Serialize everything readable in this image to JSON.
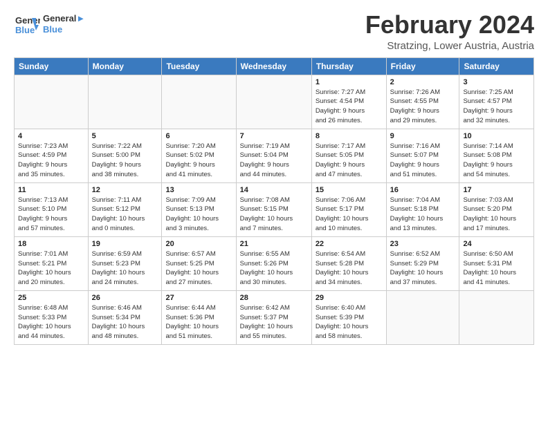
{
  "header": {
    "logo_general": "General",
    "logo_blue": "Blue",
    "month_year": "February 2024",
    "location": "Stratzing, Lower Austria, Austria"
  },
  "weekdays": [
    "Sunday",
    "Monday",
    "Tuesday",
    "Wednesday",
    "Thursday",
    "Friday",
    "Saturday"
  ],
  "weeks": [
    [
      {
        "day": "",
        "info": ""
      },
      {
        "day": "",
        "info": ""
      },
      {
        "day": "",
        "info": ""
      },
      {
        "day": "",
        "info": ""
      },
      {
        "day": "1",
        "info": "Sunrise: 7:27 AM\nSunset: 4:54 PM\nDaylight: 9 hours\nand 26 minutes."
      },
      {
        "day": "2",
        "info": "Sunrise: 7:26 AM\nSunset: 4:55 PM\nDaylight: 9 hours\nand 29 minutes."
      },
      {
        "day": "3",
        "info": "Sunrise: 7:25 AM\nSunset: 4:57 PM\nDaylight: 9 hours\nand 32 minutes."
      }
    ],
    [
      {
        "day": "4",
        "info": "Sunrise: 7:23 AM\nSunset: 4:59 PM\nDaylight: 9 hours\nand 35 minutes."
      },
      {
        "day": "5",
        "info": "Sunrise: 7:22 AM\nSunset: 5:00 PM\nDaylight: 9 hours\nand 38 minutes."
      },
      {
        "day": "6",
        "info": "Sunrise: 7:20 AM\nSunset: 5:02 PM\nDaylight: 9 hours\nand 41 minutes."
      },
      {
        "day": "7",
        "info": "Sunrise: 7:19 AM\nSunset: 5:04 PM\nDaylight: 9 hours\nand 44 minutes."
      },
      {
        "day": "8",
        "info": "Sunrise: 7:17 AM\nSunset: 5:05 PM\nDaylight: 9 hours\nand 47 minutes."
      },
      {
        "day": "9",
        "info": "Sunrise: 7:16 AM\nSunset: 5:07 PM\nDaylight: 9 hours\nand 51 minutes."
      },
      {
        "day": "10",
        "info": "Sunrise: 7:14 AM\nSunset: 5:08 PM\nDaylight: 9 hours\nand 54 minutes."
      }
    ],
    [
      {
        "day": "11",
        "info": "Sunrise: 7:13 AM\nSunset: 5:10 PM\nDaylight: 9 hours\nand 57 minutes."
      },
      {
        "day": "12",
        "info": "Sunrise: 7:11 AM\nSunset: 5:12 PM\nDaylight: 10 hours\nand 0 minutes."
      },
      {
        "day": "13",
        "info": "Sunrise: 7:09 AM\nSunset: 5:13 PM\nDaylight: 10 hours\nand 3 minutes."
      },
      {
        "day": "14",
        "info": "Sunrise: 7:08 AM\nSunset: 5:15 PM\nDaylight: 10 hours\nand 7 minutes."
      },
      {
        "day": "15",
        "info": "Sunrise: 7:06 AM\nSunset: 5:17 PM\nDaylight: 10 hours\nand 10 minutes."
      },
      {
        "day": "16",
        "info": "Sunrise: 7:04 AM\nSunset: 5:18 PM\nDaylight: 10 hours\nand 13 minutes."
      },
      {
        "day": "17",
        "info": "Sunrise: 7:03 AM\nSunset: 5:20 PM\nDaylight: 10 hours\nand 17 minutes."
      }
    ],
    [
      {
        "day": "18",
        "info": "Sunrise: 7:01 AM\nSunset: 5:21 PM\nDaylight: 10 hours\nand 20 minutes."
      },
      {
        "day": "19",
        "info": "Sunrise: 6:59 AM\nSunset: 5:23 PM\nDaylight: 10 hours\nand 24 minutes."
      },
      {
        "day": "20",
        "info": "Sunrise: 6:57 AM\nSunset: 5:25 PM\nDaylight: 10 hours\nand 27 minutes."
      },
      {
        "day": "21",
        "info": "Sunrise: 6:55 AM\nSunset: 5:26 PM\nDaylight: 10 hours\nand 30 minutes."
      },
      {
        "day": "22",
        "info": "Sunrise: 6:54 AM\nSunset: 5:28 PM\nDaylight: 10 hours\nand 34 minutes."
      },
      {
        "day": "23",
        "info": "Sunrise: 6:52 AM\nSunset: 5:29 PM\nDaylight: 10 hours\nand 37 minutes."
      },
      {
        "day": "24",
        "info": "Sunrise: 6:50 AM\nSunset: 5:31 PM\nDaylight: 10 hours\nand 41 minutes."
      }
    ],
    [
      {
        "day": "25",
        "info": "Sunrise: 6:48 AM\nSunset: 5:33 PM\nDaylight: 10 hours\nand 44 minutes."
      },
      {
        "day": "26",
        "info": "Sunrise: 6:46 AM\nSunset: 5:34 PM\nDaylight: 10 hours\nand 48 minutes."
      },
      {
        "day": "27",
        "info": "Sunrise: 6:44 AM\nSunset: 5:36 PM\nDaylight: 10 hours\nand 51 minutes."
      },
      {
        "day": "28",
        "info": "Sunrise: 6:42 AM\nSunset: 5:37 PM\nDaylight: 10 hours\nand 55 minutes."
      },
      {
        "day": "29",
        "info": "Sunrise: 6:40 AM\nSunset: 5:39 PM\nDaylight: 10 hours\nand 58 minutes."
      },
      {
        "day": "",
        "info": ""
      },
      {
        "day": "",
        "info": ""
      }
    ]
  ]
}
